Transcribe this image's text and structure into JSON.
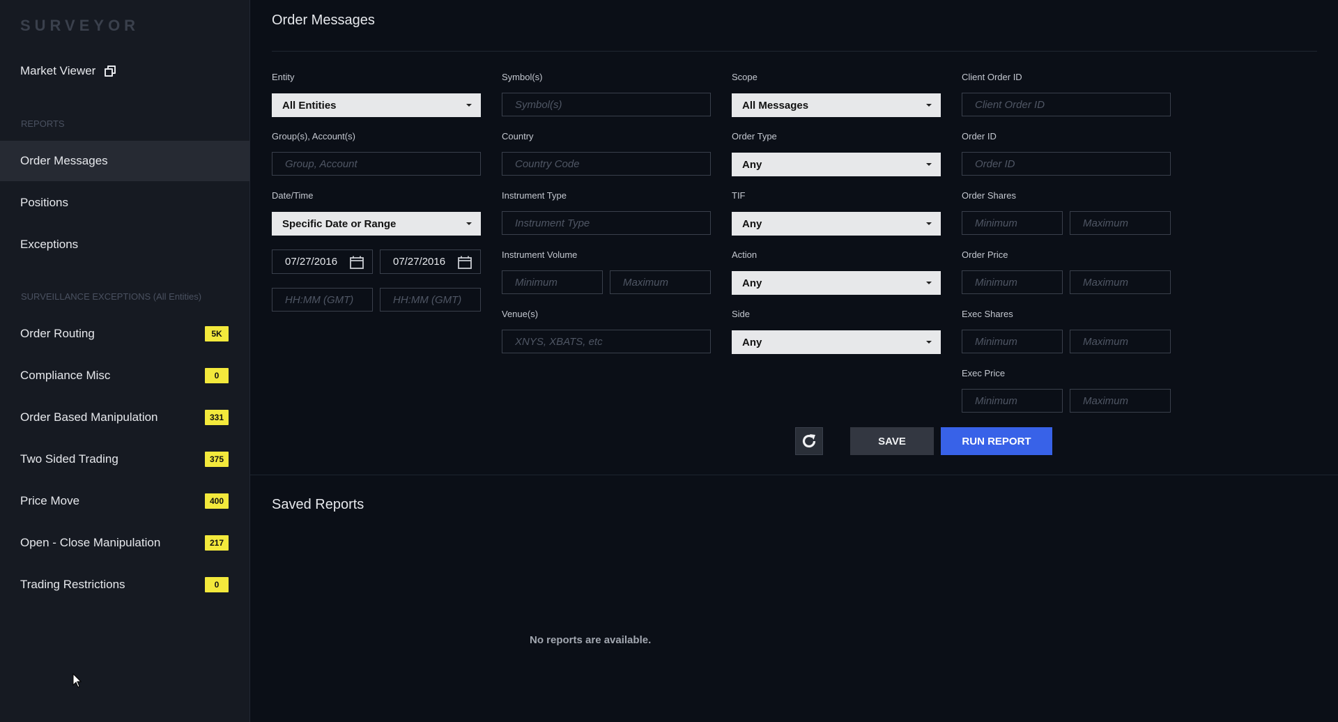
{
  "app": {
    "logo": "SURVEYOR"
  },
  "sidebar": {
    "market_viewer": "Market Viewer",
    "reports_label": "REPORTS",
    "reports": [
      {
        "label": "Order Messages",
        "active": true
      },
      {
        "label": "Positions",
        "active": false
      },
      {
        "label": "Exceptions",
        "active": false
      }
    ],
    "surveillance_label": "SURVEILLANCE EXCEPTIONS (All Entities)",
    "exceptions": [
      {
        "label": "Order Routing",
        "count": "5K"
      },
      {
        "label": "Compliance Misc",
        "count": "0"
      },
      {
        "label": "Order Based Manipulation",
        "count": "331"
      },
      {
        "label": "Two Sided Trading",
        "count": "375"
      },
      {
        "label": "Price Move",
        "count": "400"
      },
      {
        "label": "Open - Close Manipulation",
        "count": "217"
      },
      {
        "label": "Trading Restrictions",
        "count": "0"
      }
    ]
  },
  "main": {
    "title": "Order Messages",
    "col1": {
      "entity_label": "Entity",
      "entity_value": "All Entities",
      "group_label": "Group(s), Account(s)",
      "group_placeholder": "Group, Account",
      "datetime_label": "Date/Time",
      "datetime_value": "Specific Date or Range",
      "date_from": "07/27/2016",
      "date_to": "07/27/2016",
      "time_from_placeholder": "HH:MM (GMT)",
      "time_to_placeholder": "HH:MM (GMT)"
    },
    "col2": {
      "symbols_label": "Symbol(s)",
      "symbols_placeholder": "Symbol(s)",
      "country_label": "Country",
      "country_placeholder": "Country Code",
      "instrument_type_label": "Instrument Type",
      "instrument_type_placeholder": "Instrument Type",
      "instrument_volume_label": "Instrument Volume",
      "volume_min_placeholder": "Minimum",
      "volume_max_placeholder": "Maximum",
      "venues_label": "Venue(s)",
      "venues_placeholder": "XNYS, XBATS, etc"
    },
    "col3": {
      "scope_label": "Scope",
      "scope_value": "All Messages",
      "order_type_label": "Order Type",
      "order_type_value": "Any",
      "tif_label": "TIF",
      "tif_value": "Any",
      "action_label": "Action",
      "action_value": "Any",
      "side_label": "Side",
      "side_value": "Any"
    },
    "col4": {
      "client_order_id_label": "Client Order ID",
      "client_order_id_placeholder": "Client Order ID",
      "order_id_label": "Order ID",
      "order_id_placeholder": "Order ID",
      "order_shares_label": "Order Shares",
      "order_price_label": "Order Price",
      "exec_shares_label": "Exec Shares",
      "exec_price_label": "Exec Price",
      "min_placeholder": "Minimum",
      "max_placeholder": "Maximum"
    },
    "buttons": {
      "save": "SAVE",
      "run": "RUN REPORT"
    },
    "saved_reports_title": "Saved Reports",
    "saved_reports_empty": "No reports are available."
  }
}
